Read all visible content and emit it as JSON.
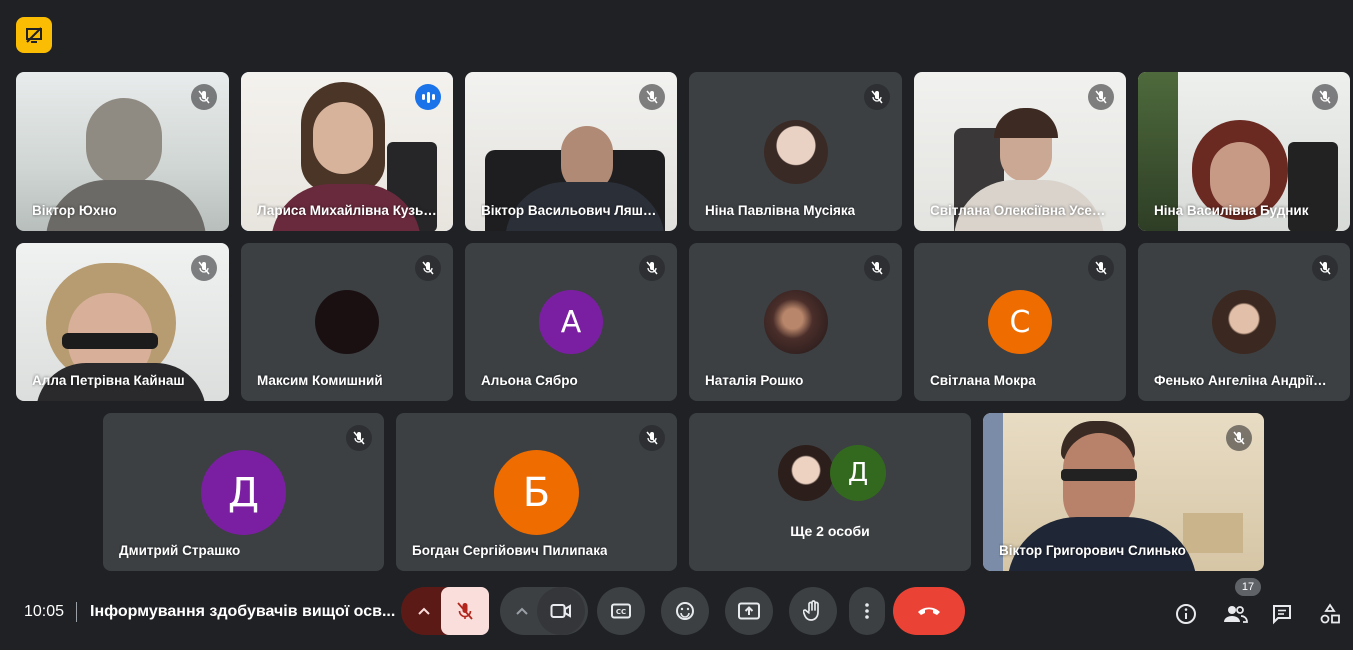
{
  "participants": {
    "p1_name": "Віктор Юхно",
    "p2_name": "Лариса Михайлівна Кузьмич",
    "p3_name": "Віктор Васильович Ляшенко",
    "p4_name": "Ніна Павлівна Мусіяка",
    "p5_name": "Світлана Олексіївна Усенко",
    "p6_name": "Ніна Василівна Будник",
    "p7_name": "Алла Петрівна Кайнаш",
    "p8_name": "Максим Комишний",
    "p9_name": "Альона Сябро",
    "p9_initial": "А",
    "p10_name": "Наталія Рошко",
    "p11_name": "Світлана Мокра",
    "p11_initial": "С",
    "p12_name": "Фенько Ангеліна Андріївна",
    "p13_name": "Дмитрий Страшко",
    "p13_initial": "Д",
    "p14_name": "Богдан Сергійович Пилипака",
    "p14_initial": "Б",
    "more_initial": "Д",
    "more_label": "Ще 2 особи",
    "p16_name": "Віктор Григорович Слинько"
  },
  "footer": {
    "time": "10:05",
    "meeting_title": "Інформування здобувачів вищої осв...",
    "participant_count": "17"
  },
  "colors": {
    "background": "#202124",
    "tile": "#3c4043",
    "active_border": "#8ab4f8",
    "mic_muted_bg": "#f9dedc",
    "mic_muted_fg": "#b3261e",
    "end_call": "#ea4335",
    "purple": "#7b1fa2",
    "orange": "#ef6c00",
    "green": "#33691e",
    "badge": "#fbbc04"
  },
  "icons": [
    "presentation-off-icon",
    "mic-off-icon",
    "audio-level-icon",
    "chevron-up-icon",
    "camera-icon",
    "captions-icon",
    "emoji-icon",
    "present-screen-icon",
    "raise-hand-icon",
    "more-options-icon",
    "end-call-icon",
    "info-icon",
    "people-icon",
    "chat-icon",
    "activities-icon"
  ]
}
